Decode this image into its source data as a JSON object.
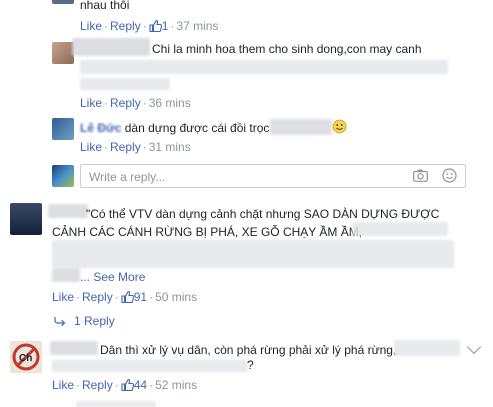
{
  "thread": {
    "comment_top": {
      "text_tail": "nhau thôi",
      "like": "Like",
      "reply": "Reply",
      "likes": "1",
      "time": "37 mins"
    },
    "reply1": {
      "text": "Chi la minh hoa them cho sinh dong,con may canh",
      "like": "Like",
      "reply": "Reply",
      "time": "36 mins"
    },
    "reply2": {
      "name_partial": "Lê Đức",
      "text": "dàn dựng được cái đồi trọc",
      "like": "Like",
      "reply": "Reply",
      "time": "31 mins"
    },
    "reply_box": {
      "placeholder": "Write a reply..."
    },
    "comment2": {
      "line1": "\"Có thể VTV dàn dựng cảnh chặt nhưng SAO DÀN DỰNG ĐƯỢC",
      "line2": "CẢNH CÁC CÁNH RỪNG BỊ PHÁ, XE GỖ CHẠY ẦM ẦM,",
      "see_more": "See More",
      "like": "Like",
      "reply": "Reply",
      "likes": "91",
      "time": "50 mins",
      "replies_link": "1 Reply"
    },
    "comment3": {
      "line1": "Dân thì xử lý vụ dân, còn phá rừng phải xử lý phá rừng,",
      "line2_tail": "?",
      "like": "Like",
      "reply": "Reply",
      "likes": "44",
      "time": "52 mins"
    }
  },
  "colors": {
    "link": "#4267b2",
    "meta": "#8d949e",
    "border": "#ccd0d5"
  }
}
